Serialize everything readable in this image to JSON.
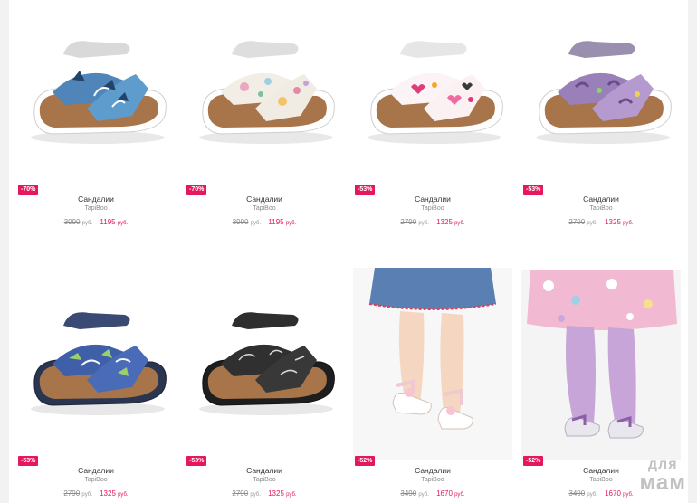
{
  "products": [
    {
      "badge": "-70%",
      "name": "Сандалии",
      "brand": "TapiBoo",
      "old_price": "3990",
      "new_price": "1195",
      "currency": "руб.",
      "pattern": "blue-leaf-print"
    },
    {
      "badge": "-70%",
      "name": "Сандалии",
      "brand": "TapiBoo",
      "old_price": "3990",
      "new_price": "1195",
      "currency": "руб.",
      "pattern": "pastel-flower-print"
    },
    {
      "badge": "-53%",
      "name": "Сандалии",
      "brand": "TapiBoo",
      "old_price": "2790",
      "new_price": "1325",
      "currency": "руб.",
      "pattern": "pink-heart-print"
    },
    {
      "badge": "-53%",
      "name": "Сандалии",
      "brand": "TapiBoo",
      "old_price": "2790",
      "new_price": "1325",
      "currency": "руб.",
      "pattern": "purple-print"
    },
    {
      "badge": "-53%",
      "name": "Сандалии",
      "brand": "TapiBoo",
      "old_price": "2790",
      "new_price": "1325",
      "currency": "руб.",
      "pattern": "blue-graffiti-print"
    },
    {
      "badge": "-53%",
      "name": "Сандалии",
      "brand": "TapiBoo",
      "old_price": "2790",
      "new_price": "1325",
      "currency": "руб.",
      "pattern": "black-print"
    },
    {
      "badge": "-52%",
      "name": "Сандалии",
      "brand": "TapiBoo",
      "old_price": "3490",
      "new_price": "1670",
      "currency": "руб.",
      "pattern": "kid-wearing-white-sandals"
    },
    {
      "badge": "-52%",
      "name": "Сандалии",
      "brand": "TapiBoo",
      "old_price": "3490",
      "new_price": "1670",
      "currency": "руб.",
      "pattern": "kid-wearing-silver-sandals"
    }
  ],
  "watermark": {
    "line1": "для",
    "line2": "мам"
  },
  "colors": {
    "sale": "#e5185d",
    "price_old": "#8c8c8c",
    "text": "#333333"
  }
}
